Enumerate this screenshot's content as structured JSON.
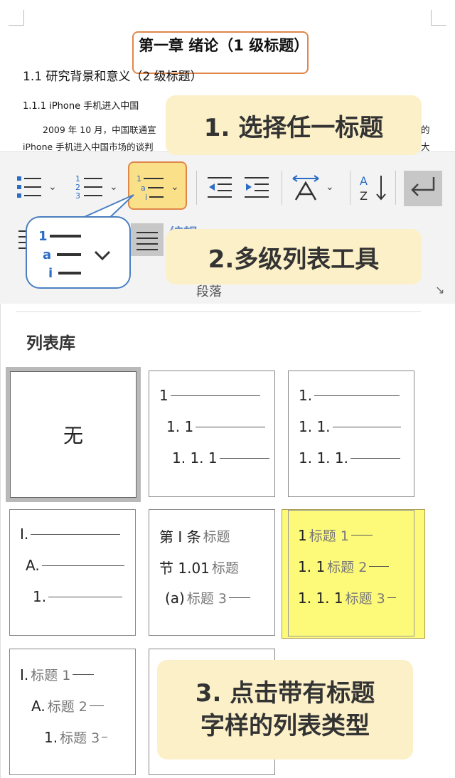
{
  "document": {
    "heading1": "第一章  绪论（1 级标题）",
    "heading2": "1.1 研究背景和意义（2 级标题）",
    "heading3": "1.1.1  iPhone 手机进入中国",
    "body_line1": "2009 年 10 月，中国联通宣",
    "body_line1_right": "的",
    "body_line2": "iPhone 手机进入中国市场的谈判",
    "body_line2_right": "大"
  },
  "callouts": {
    "step1": "1. 选择任一标题",
    "step2": "2.多级列表工具",
    "step3_line1": "3. 点击带有标题",
    "step3_line2": "字样的列表类型"
  },
  "ribbon": {
    "group_label": "段落",
    "partial_text": "编辑",
    "icons": [
      "bullet-list-icon",
      "numbered-list-icon",
      "multilevel-list-icon",
      "decrease-indent-icon",
      "increase-indent-icon",
      "asian-layout-icon",
      "sort-icon",
      "show-marks-icon"
    ]
  },
  "gallery": {
    "title": "列表库",
    "none_label": "无",
    "tiles": [
      {
        "rows": [
          {
            "num": "1",
            "label": ""
          },
          {
            "num": "1. 1",
            "label": ""
          },
          {
            "num": "1. 1. 1",
            "label": ""
          }
        ]
      },
      {
        "rows": [
          {
            "num": "1.",
            "label": ""
          },
          {
            "num": "1. 1.",
            "label": ""
          },
          {
            "num": "1. 1. 1.",
            "label": ""
          }
        ]
      },
      {
        "rows": [
          {
            "num": "I.",
            "label": ""
          },
          {
            "num": "A.",
            "label": ""
          },
          {
            "num": "1.",
            "label": ""
          }
        ]
      },
      {
        "rows": [
          {
            "num": "第 I 条",
            "label": "标题"
          },
          {
            "num": "节 1.01",
            "label": "标题"
          },
          {
            "num": "(a)",
            "label": "标题 3"
          }
        ]
      },
      {
        "rows": [
          {
            "num": "1",
            "label": "标题 1"
          },
          {
            "num": "1. 1",
            "label": "标题 2"
          },
          {
            "num": "1. 1. 1",
            "label": "标题 3"
          }
        ]
      },
      {
        "rows": [
          {
            "num": "I.",
            "label": "标题 1"
          },
          {
            "num": "A.",
            "label": "标题 2"
          },
          {
            "num": "1.",
            "label": "标题 3"
          }
        ]
      }
    ]
  },
  "colors": {
    "callout_bg": "#fbf0c8",
    "highlight_orange": "#e0874a",
    "highlight_yellow": "#fdfa7a",
    "accent_blue": "#4a7fc1"
  }
}
